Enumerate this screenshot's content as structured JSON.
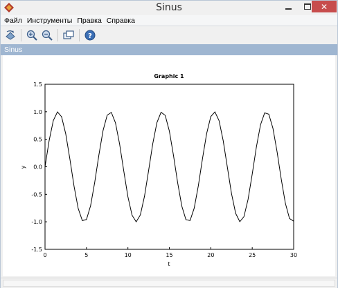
{
  "window": {
    "title": "Sinus",
    "close_symbol": "✕"
  },
  "menu": {
    "items": [
      "Файл",
      "Инструменты",
      "Правка",
      "Справка"
    ]
  },
  "toolbar": {
    "icons": [
      "rotate-icon",
      "zoom-in-icon",
      "zoom-out-icon",
      "datatip-icon",
      "help-icon"
    ]
  },
  "panel": {
    "title": "Sinus"
  },
  "chart_data": {
    "type": "line",
    "title": "Graphic 1",
    "xlabel": "t",
    "ylabel": "y",
    "xlim": [
      0,
      30
    ],
    "ylim": [
      -1.5,
      1.5
    ],
    "xticks": [
      0,
      5,
      10,
      15,
      20,
      25,
      30
    ],
    "yticks": [
      -1.5,
      -1.0,
      -0.5,
      0.0,
      0.5,
      1.0,
      1.5
    ],
    "xtick_labels": [
      "0",
      "5",
      "10",
      "15",
      "20",
      "25",
      "30"
    ],
    "ytick_labels": [
      "-1.5",
      "-1.0",
      "-0.5",
      "0.0",
      "0.5",
      "1.0",
      "1.5"
    ],
    "grid": false,
    "series": [
      {
        "function": "sin",
        "color": "#000000",
        "x": [
          0,
          0.5,
          1.0,
          1.5,
          2.0,
          2.5,
          3.0,
          3.5,
          4.0,
          4.5,
          5.0,
          5.5,
          6.0,
          6.5,
          7.0,
          7.5,
          8.0,
          8.5,
          9.0,
          9.5,
          10.0,
          10.5,
          11.0,
          11.5,
          12.0,
          12.5,
          13.0,
          13.5,
          14.0,
          14.5,
          15.0,
          15.5,
          16.0,
          16.5,
          17.0,
          17.5,
          18.0,
          18.5,
          19.0,
          19.5,
          20.0,
          20.5,
          21.0,
          21.5,
          22.0,
          22.5,
          23.0,
          23.5,
          24.0,
          24.5,
          25.0,
          25.5,
          26.0,
          26.5,
          27.0,
          27.5,
          28.0,
          28.5,
          29.0,
          29.5,
          30.0
        ],
        "y": [
          0.0,
          0.479,
          0.841,
          0.997,
          0.909,
          0.598,
          0.141,
          -0.351,
          -0.757,
          -0.978,
          -0.959,
          -0.706,
          -0.279,
          0.215,
          0.657,
          0.938,
          0.989,
          0.798,
          0.412,
          -0.075,
          -0.544,
          -0.88,
          -1.0,
          -0.875,
          -0.537,
          -0.066,
          0.42,
          0.803,
          0.991,
          0.935,
          0.65,
          0.206,
          -0.288,
          -0.712,
          -0.961,
          -0.977,
          -0.751,
          -0.343,
          0.15,
          0.604,
          0.913,
          0.997,
          0.837,
          0.472,
          -0.009,
          -0.487,
          -0.846,
          -0.998,
          -0.906,
          -0.591,
          -0.132,
          0.359,
          0.763,
          0.98,
          0.956,
          0.699,
          0.271,
          -0.224,
          -0.664,
          -0.941,
          -0.988
        ]
      }
    ]
  }
}
